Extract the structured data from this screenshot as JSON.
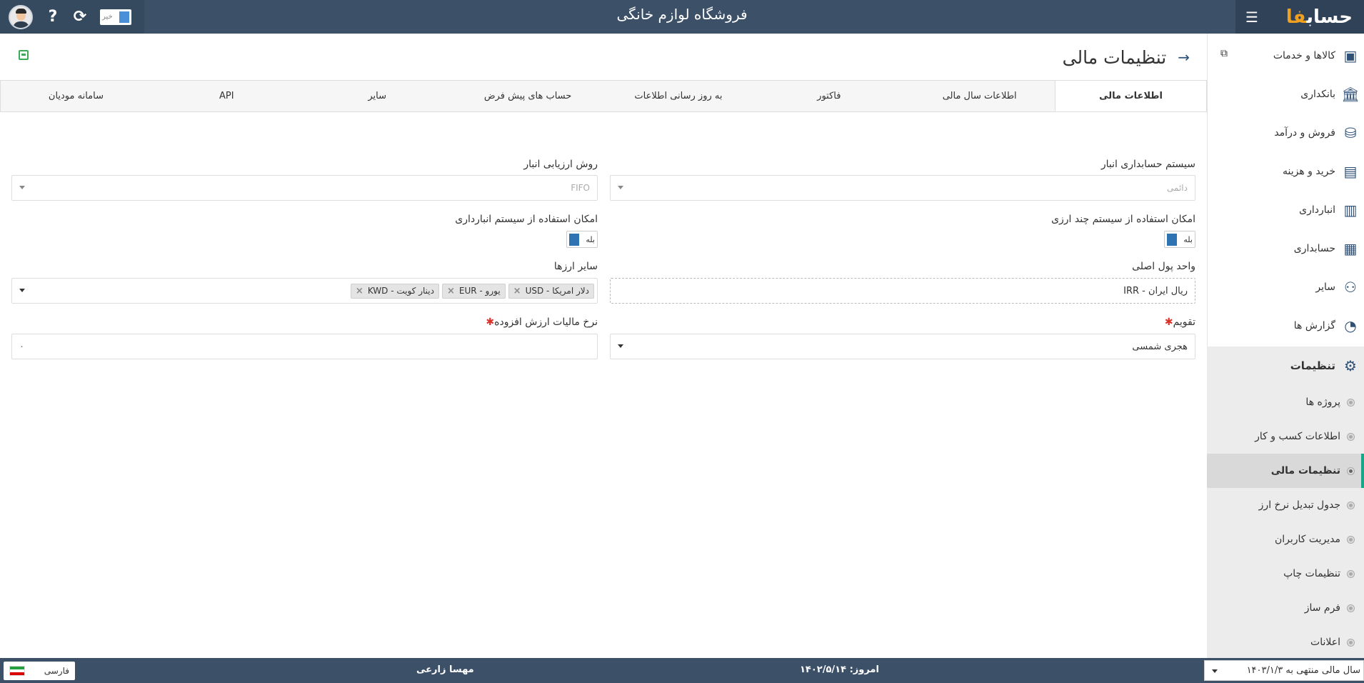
{
  "app": {
    "logo": "حساب",
    "logo_accent": "فا",
    "store_title": "فروشگاه لوازم خانگی",
    "top_toggle": "خیر"
  },
  "sidebar": {
    "items": [
      {
        "label": "کالاها و خدمات",
        "icon": "box-icon"
      },
      {
        "label": "بانکداری",
        "icon": "bank-icon"
      },
      {
        "label": "فروش و درآمد",
        "icon": "sales-icon"
      },
      {
        "label": "خرید و هزینه",
        "icon": "wallet-icon"
      },
      {
        "label": "انبارداری",
        "icon": "warehouse-icon"
      },
      {
        "label": "حسابداری",
        "icon": "ledger-icon"
      },
      {
        "label": "سایر",
        "icon": "misc-icon"
      },
      {
        "label": "گزارش ها",
        "icon": "report-icon"
      }
    ],
    "settings_label": "تنظیمات",
    "settings_sub": [
      "پروژه ها",
      "اطلاعات کسب و کار",
      "تنظیمات مالی",
      "جدول تبدیل نرخ ارز",
      "مدیریت کاربران",
      "تنظیمات چاپ",
      "فرم ساز",
      "اعلانات"
    ]
  },
  "page": {
    "title": "تنظیمات مالی"
  },
  "tabs": [
    "اطلاعات مالی",
    "اطلاعات سال مالی",
    "فاکتور",
    "به روز رسانی اطلاعات",
    "حساب های پیش فرض",
    "سایر",
    "API",
    "سامانه مودیان"
  ],
  "form": {
    "inventory_system_label": "سیستم حسابداری انبار",
    "inventory_system_value": "دائمی",
    "valuation_label": "روش ارزیابی انبار",
    "valuation_value": "FIFO",
    "multi_currency_label": "امکان استفاده از سیستم چند ارزی",
    "multi_currency_value": "بله",
    "warehouse_system_label": "امکان استفاده از سیستم انبارداری",
    "warehouse_system_value": "بله",
    "main_currency_label": "واحد پول اصلی",
    "main_currency_value": "IRR - ریال ایران",
    "other_currencies_label": "سایر ارزها",
    "other_currencies": [
      "USD - دلار امریکا",
      "EUR - یورو",
      "KWD - دینار کویت"
    ],
    "calendar_label": "تقویم",
    "calendar_value": "هجری شمسی",
    "vat_label": "نرخ مالیات ارزش افزوده",
    "vat_value": "۰"
  },
  "footer": {
    "language": "فارسی",
    "user": "مهسا زارعی",
    "today_label": "امروز:",
    "today_value": "۱۴۰۲/۵/۱۴",
    "fiscal_year": "سال مالی منتهی به ۱۴۰۳/۱/۳"
  }
}
